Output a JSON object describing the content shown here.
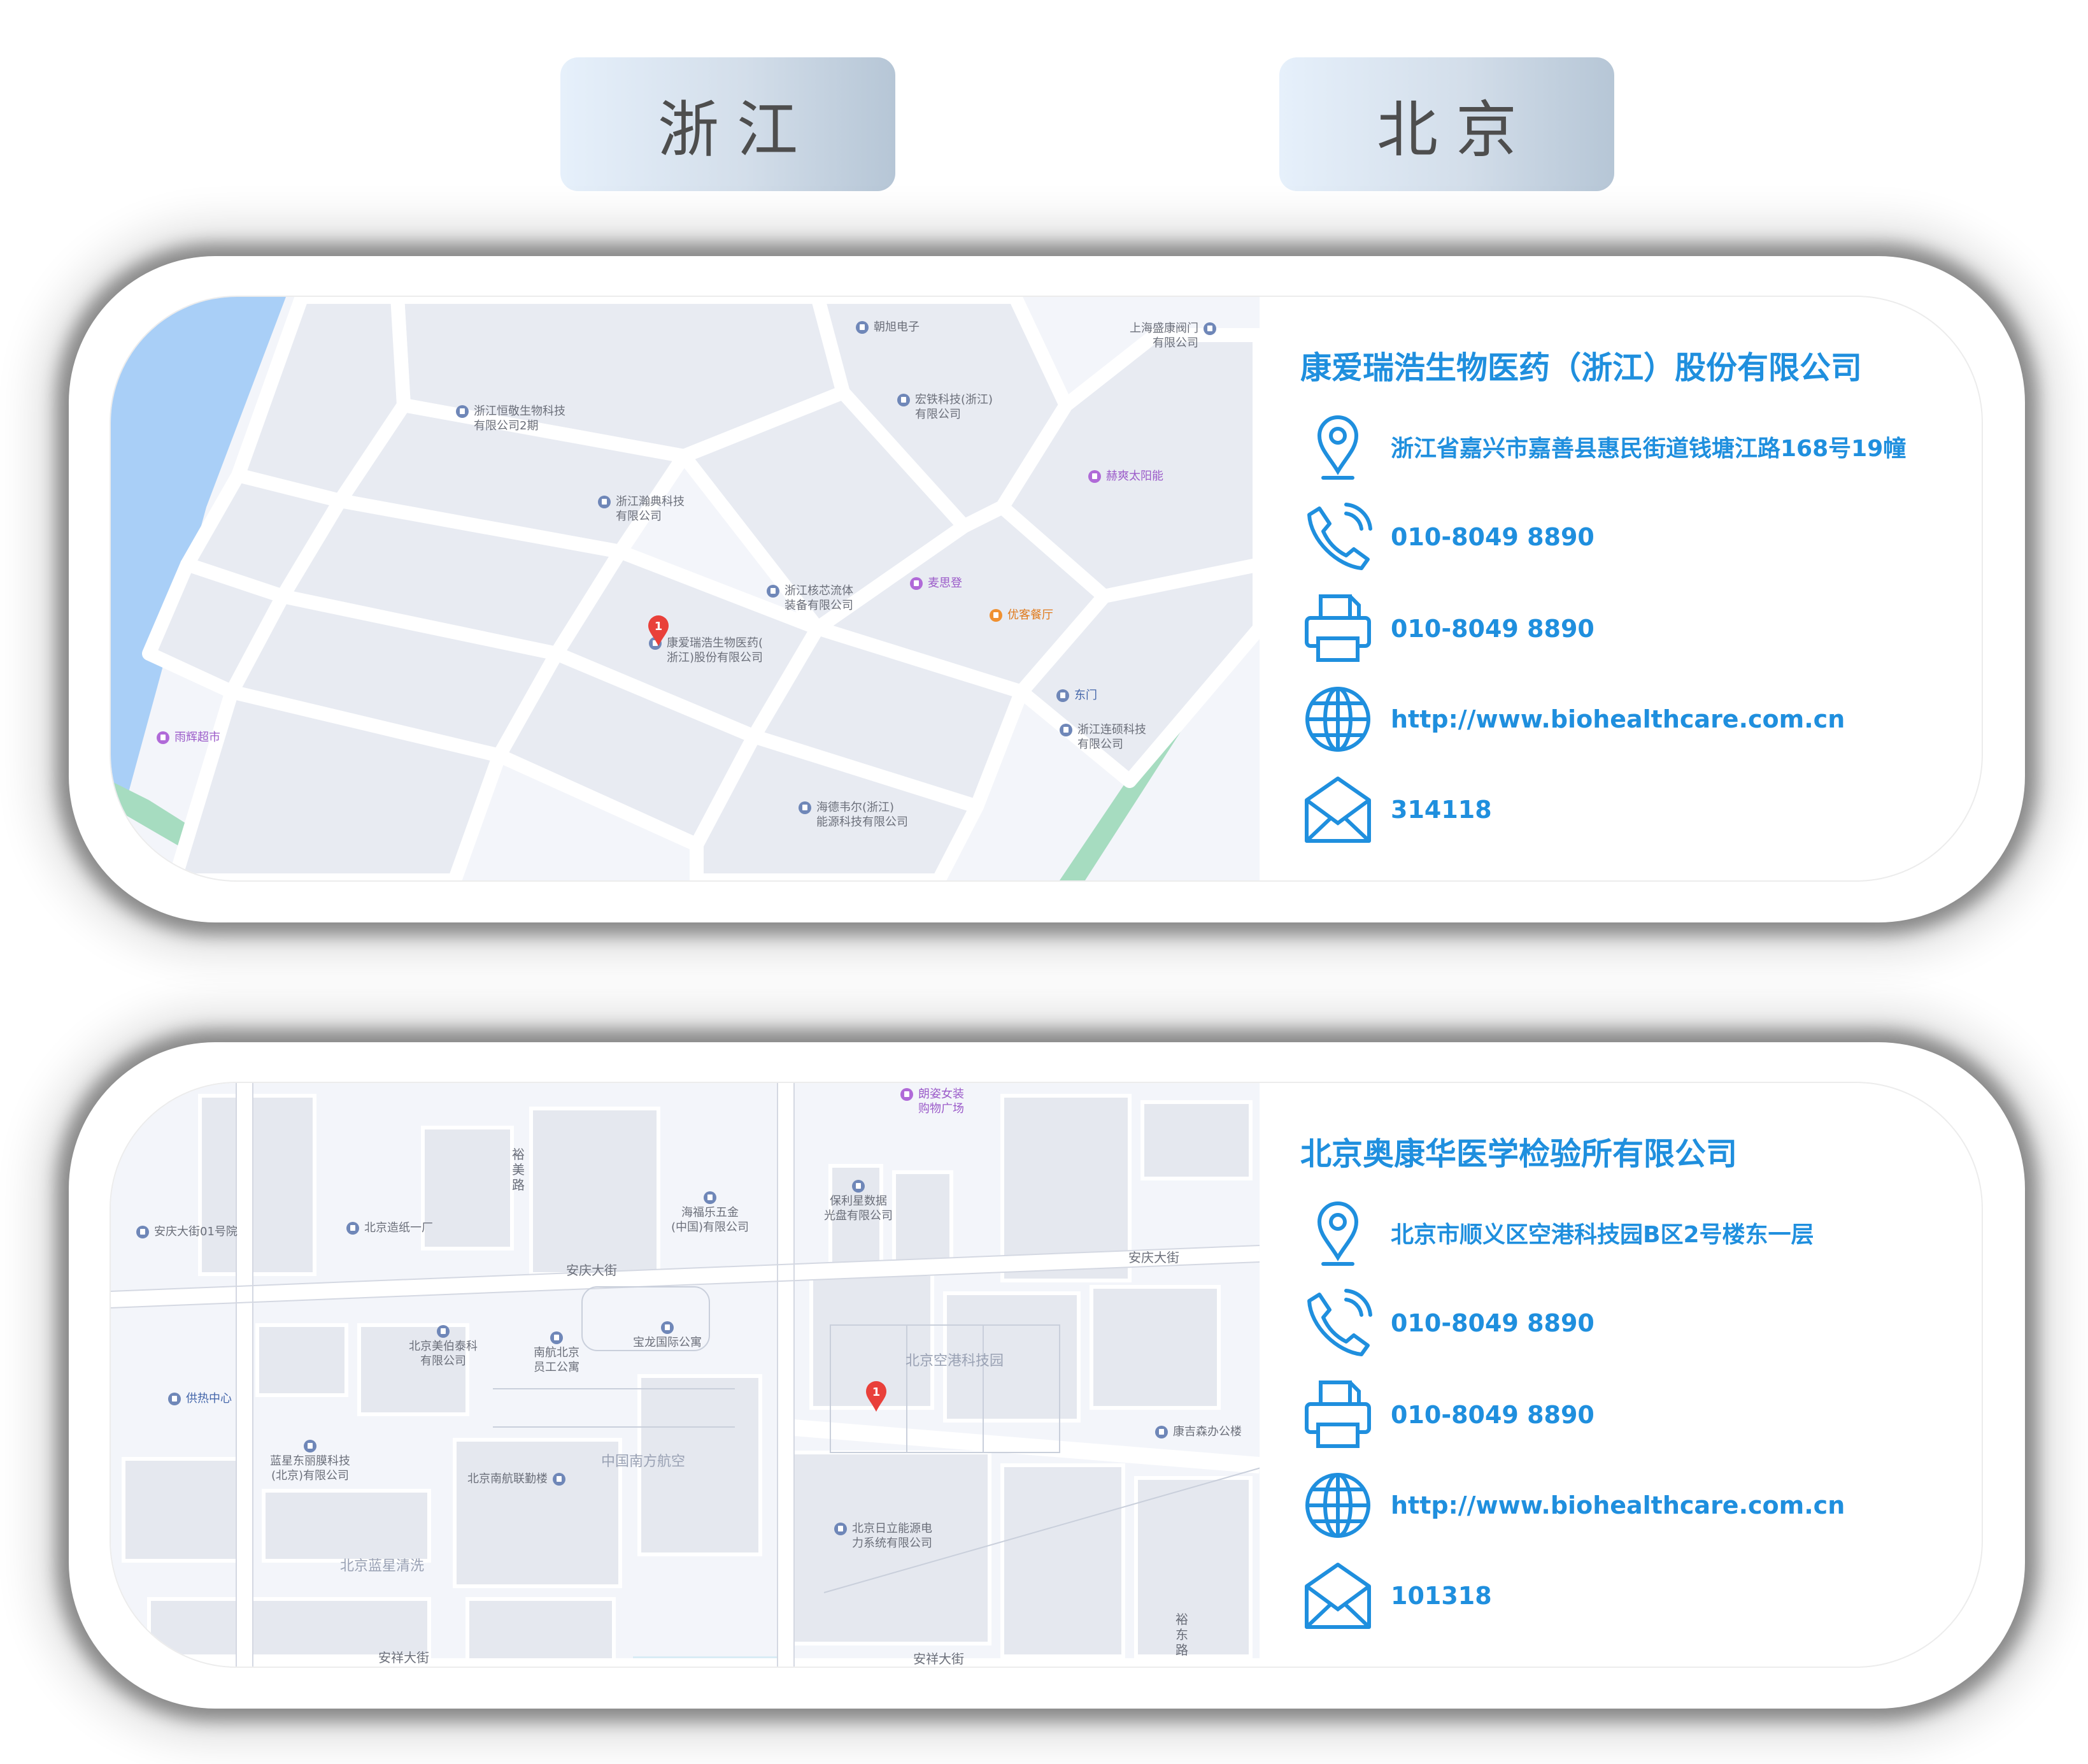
{
  "tabs": [
    {
      "label": "浙江"
    },
    {
      "label": "北京"
    }
  ],
  "zhejiang": {
    "company": "康爱瑞浩生物医药（浙江）股份有限公司",
    "address": "浙江省嘉兴市嘉善县惠民街道钱塘江路168号19幢",
    "phone": "010-8049 8890",
    "fax": "010-8049 8890",
    "website": "http://www.biohealthcare.com.cn",
    "postcode": "314118",
    "map": {
      "marker": "1",
      "pois": [
        {
          "label": "朝旭电子",
          "style": "gray"
        },
        {
          "label": "上海盛康阀门\n有限公司",
          "style": "gray"
        },
        {
          "label": "浙江恒敬生物科技\n有限公司2期",
          "style": "gray"
        },
        {
          "label": "宏铁科技(浙江)\n有限公司",
          "style": "gray"
        },
        {
          "label": "赫爽太阳能",
          "style": "purple"
        },
        {
          "label": "浙江瀚典科技\n有限公司",
          "style": "gray"
        },
        {
          "label": "麦思登",
          "style": "purple"
        },
        {
          "label": "浙江核芯流体\n装备有限公司",
          "style": "gray"
        },
        {
          "label": "优客餐厅",
          "style": "orange"
        },
        {
          "label": "康爱瑞浩生物医药(\n浙江)股份有限公司",
          "style": "gray"
        },
        {
          "label": "东门",
          "style": "blue"
        },
        {
          "label": "浙江连硕科技\n有限公司",
          "style": "gray"
        },
        {
          "label": "雨辉超市",
          "style": "purple"
        },
        {
          "label": "海德韦尔(浙江)\n能源科技有限公司",
          "style": "gray"
        }
      ]
    }
  },
  "beijing": {
    "company": "北京奥康华医学检验所有限公司",
    "address": "北京市顺义区空港科技园B区2号楼东一层",
    "phone": "010-8049 8890",
    "fax": "010-8049 8890",
    "website": "http://www.biohealthcare.com.cn",
    "postcode": "101318",
    "map": {
      "marker": "1",
      "pois": [
        {
          "label": "朗姿女装\n购物广场",
          "style": "purple"
        },
        {
          "label": "保利星数据\n光盘有限公司",
          "style": "gray"
        },
        {
          "label": "海福乐五金\n(中国)有限公司",
          "style": "gray"
        },
        {
          "label": "安庆大街01号院",
          "style": "gray"
        },
        {
          "label": "北京造纸一厂",
          "style": "gray"
        },
        {
          "label": "北京美伯泰科\n有限公司",
          "style": "gray"
        },
        {
          "label": "南航北京\n员工公寓",
          "style": "gray"
        },
        {
          "label": "宝龙国际公寓",
          "style": "gray"
        },
        {
          "label": "供热中心",
          "style": "blue"
        },
        {
          "label": "康吉森办公楼",
          "style": "gray"
        },
        {
          "label": "蓝星东丽膜科技\n(北京)有限公司",
          "style": "gray"
        },
        {
          "label": "北京南航联勤楼",
          "style": "gray"
        },
        {
          "label": "北京日立能源电\n力系统有限公司",
          "style": "gray"
        }
      ],
      "roads": [
        {
          "label": "裕\n美\n路"
        },
        {
          "label": "安庆大街"
        },
        {
          "label": "安庆大街"
        },
        {
          "label": "安祥大街"
        },
        {
          "label": "安祥大街"
        },
        {
          "label": "裕\n东\n路"
        }
      ],
      "areas": [
        {
          "label": "北京空港科技园"
        },
        {
          "label": "中国南方航空"
        },
        {
          "label": "北京蓝星清洗"
        }
      ]
    }
  },
  "icons": [
    "location-pin-icon",
    "phone-icon",
    "fax-printer-icon",
    "globe-icon",
    "envelope-icon"
  ],
  "colors": {
    "accent": "#1f8fde",
    "water": "#a9cff7",
    "greenbelt": "#a6dcc0",
    "map_bg": "#f3f5fa",
    "block": "#e8ebf2",
    "marker": "#e9403a"
  }
}
